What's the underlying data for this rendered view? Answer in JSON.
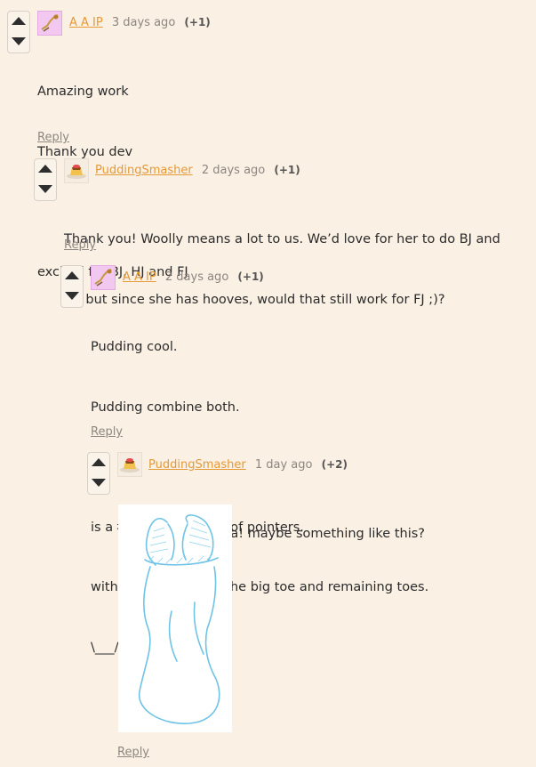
{
  "comments": [
    {
      "author": "A A IP",
      "time": "3 days ago",
      "score": "(+1)",
      "lines": [
        "Amazing work",
        "Thank you dev",
        "",
        "excited for BJ, HJ and FJ"
      ],
      "reply": "Reply",
      "avatar_icon": "fox-figure-icon"
    },
    {
      "author": "PuddingSmasher",
      "time": "2 days ago",
      "score": "(+1)",
      "lines": [
        "Thank you! Woolly means a lot to us. We’d love for her to do BJ and",
        "HJ, but since she has hooves, would that still work for FJ ;)?"
      ],
      "reply": "Reply",
      "avatar_icon": "pudding-icon"
    },
    {
      "author": "A A IP",
      "time": "2 days ago",
      "score": "(+1)",
      "lines": [
        "Pudding cool.",
        "Pudding combine both.",
        "",
        "is a foot, with cute hoof pointers.",
        "with a split between the big toe and remaining toes.",
        "\\___/\\/       \\/\\___/"
      ],
      "reply": "Reply",
      "avatar_icon": "fox-figure-icon"
    },
    {
      "author": "PuddingSmasher",
      "time": "1 day ago",
      "score": "(+2)",
      "lines": [
        "That's a great idea! maybe something like this?"
      ],
      "reply": "Reply",
      "avatar_icon": "pudding-icon",
      "image_desc": "hoof-foot-sketch"
    }
  ],
  "colors": {
    "background": "#faf0e4",
    "author": "#e59a35",
    "muted": "#8d8680",
    "sketch_line": "#6fc3e6"
  }
}
